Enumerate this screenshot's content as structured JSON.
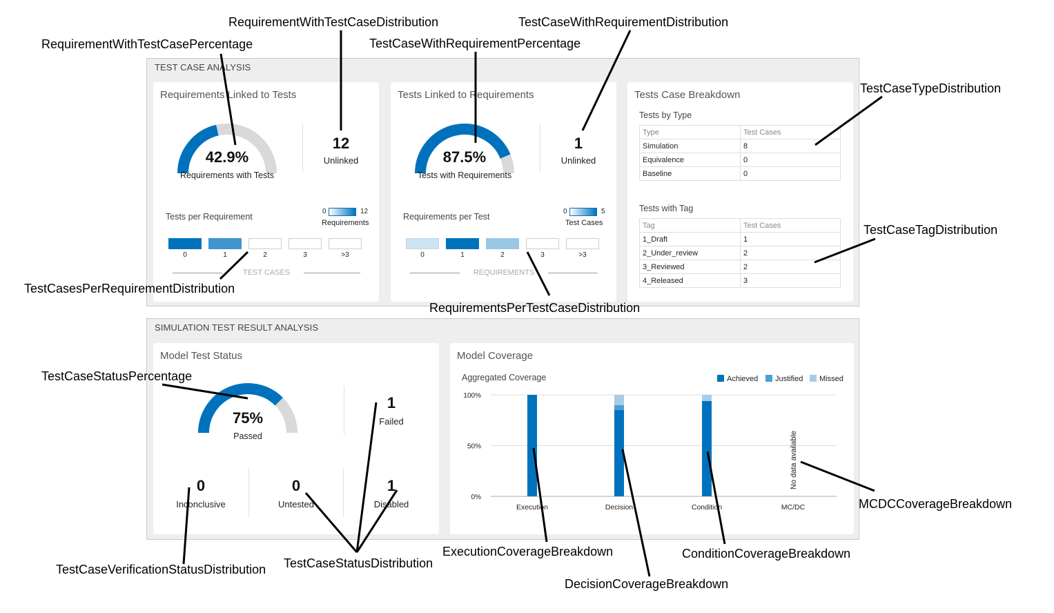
{
  "sections": {
    "test_case_analysis": "TEST CASE ANALYSIS",
    "simulation_analysis": "SIMULATION TEST RESULT ANALYSIS"
  },
  "colors": {
    "achieved": "#0072bd",
    "justified": "#4d9fd6",
    "missed": "#a8cce8",
    "gauge_track": "#d9d9d9"
  },
  "req_linked": {
    "title": "Requirements Linked to Tests",
    "gauge_value": "42.9%",
    "gauge_fraction": 0.429,
    "gauge_label": "Requirements with Tests",
    "unlinked_count": "12",
    "unlinked_label": "Unlinked",
    "dist_title": "Tests per Requirement",
    "legend_min": "0",
    "legend_max": "12",
    "legend_unit": "Requirements",
    "axis_title": "TEST CASES",
    "bins": [
      {
        "label": "0",
        "intensity": 1.0
      },
      {
        "label": "1",
        "intensity": 0.75
      },
      {
        "label": "2",
        "intensity": 0
      },
      {
        "label": "3",
        "intensity": 0
      },
      {
        "label": ">3",
        "intensity": 0
      }
    ]
  },
  "tests_linked": {
    "title": "Tests Linked to Requirements",
    "gauge_value": "87.5%",
    "gauge_fraction": 0.875,
    "gauge_label": "Tests with Requirements",
    "unlinked_count": "1",
    "unlinked_label": "Unlinked",
    "dist_title": "Requirements per Test",
    "legend_min": "0",
    "legend_max": "5",
    "legend_unit": "Test Cases",
    "axis_title": "REQUIREMENTS",
    "bins": [
      {
        "label": "0",
        "intensity": 0.2
      },
      {
        "label": "1",
        "intensity": 1.0
      },
      {
        "label": "2",
        "intensity": 0.4
      },
      {
        "label": "3",
        "intensity": 0
      },
      {
        "label": ">3",
        "intensity": 0
      }
    ]
  },
  "breakdown": {
    "title": "Tests Case Breakdown",
    "by_type_title": "Tests by Type",
    "by_type_headers": [
      "Type",
      "Test Cases"
    ],
    "by_type_rows": [
      [
        "Simulation",
        "8"
      ],
      [
        "Equivalence",
        "0"
      ],
      [
        "Baseline",
        "0"
      ]
    ],
    "by_tag_title": "Tests with Tag",
    "by_tag_headers": [
      "Tag",
      "Test Cases"
    ],
    "by_tag_rows": [
      [
        "1_Draft",
        "1"
      ],
      [
        "2_Under_review",
        "2"
      ],
      [
        "3_Reviewed",
        "2"
      ],
      [
        "4_Released",
        "3"
      ]
    ]
  },
  "model_status": {
    "title": "Model Test Status",
    "gauge_value": "75%",
    "gauge_fraction": 0.75,
    "gauge_label": "Passed",
    "failed_count": "1",
    "failed_label": "Failed",
    "inconclusive_count": "0",
    "inconclusive_label": "Inconclusive",
    "untested_count": "0",
    "untested_label": "Untested",
    "disabled_count": "1",
    "disabled_label": "Disabled"
  },
  "coverage": {
    "title": "Model Coverage",
    "subtitle": "Aggregated Coverage",
    "no_data_text": "No data available"
  },
  "chart_data": {
    "type": "bar",
    "stacked": true,
    "title": "Aggregated Coverage",
    "categories": [
      "Execution",
      "Decision",
      "Condition",
      "MC/DC"
    ],
    "series": [
      {
        "name": "Achieved",
        "values": [
          100,
          85,
          94,
          null
        ]
      },
      {
        "name": "Justified",
        "values": [
          0,
          5,
          0,
          null
        ]
      },
      {
        "name": "Missed",
        "values": [
          0,
          10,
          6,
          null
        ]
      }
    ],
    "yticks": [
      "0%",
      "50%",
      "100%"
    ],
    "ylim": [
      0,
      100
    ],
    "legend": "top-right",
    "grid": true
  },
  "annotations": {
    "req_pct": "RequirementWithTestCasePercentage",
    "req_dist": "RequirementWithTestCaseDistribution",
    "tc_pct": "TestCaseWithRequirementPercentage",
    "tc_dist": "TestCaseWithRequirementDistribution",
    "type_dist": "TestCaseTypeDistribution",
    "tag_dist": "TestCaseTagDistribution",
    "tc_per_req": "TestCasesPerRequirementDistribution",
    "req_per_tc": "RequirementsPerTestCaseDistribution",
    "status_pct": "TestCaseStatusPercentage",
    "verif_dist": "TestCaseVerificationStatusDistribution",
    "status_dist": "TestCaseStatusDistribution",
    "exec_cov": "ExecutionCoverageBreakdown",
    "dec_cov": "DecisionCoverageBreakdown",
    "cond_cov": "ConditionCoverageBreakdown",
    "mcdc_cov": "MCDCCoverageBreakdown"
  }
}
